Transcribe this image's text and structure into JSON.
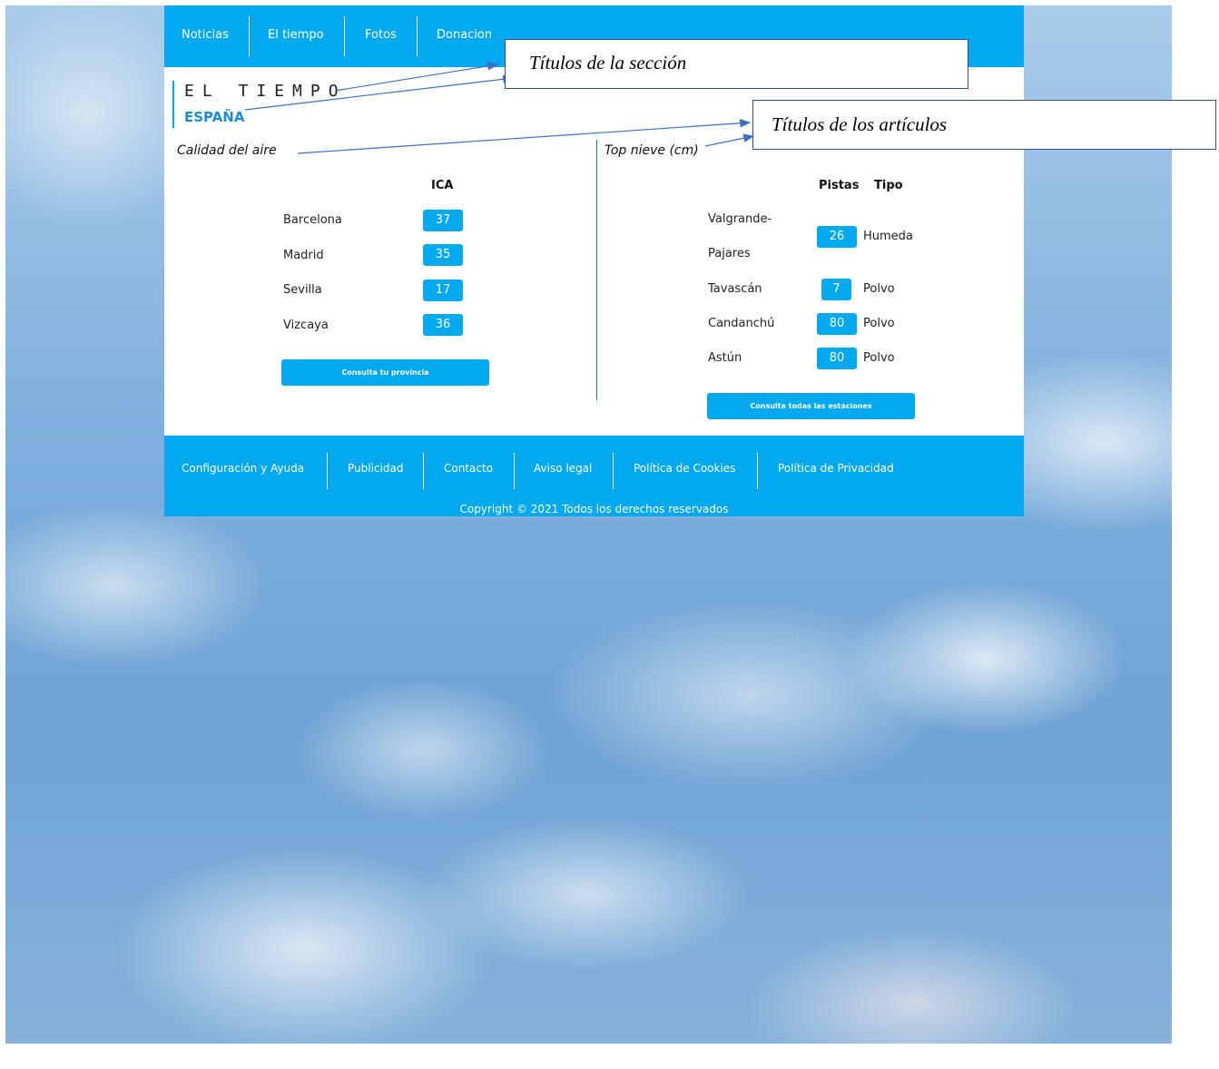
{
  "nav": {
    "items": [
      "Noticias",
      "El tiempo",
      "Fotos",
      "Donacion"
    ]
  },
  "brand": {
    "title": "EL TIEMPO",
    "subtitle": "ESPAÑA"
  },
  "air_quality": {
    "title": "Calidad del aire",
    "header": "ICA",
    "rows": [
      {
        "city": "Barcelona",
        "value": "37"
      },
      {
        "city": "Madrid",
        "value": "35"
      },
      {
        "city": "Sevilla",
        "value": "17"
      },
      {
        "city": "Vizcaya",
        "value": "36"
      }
    ],
    "button_label": "Consulta tu provincia"
  },
  "snow": {
    "title": "Top nieve (cm)",
    "header_pistas": "Pistas",
    "header_tipo": "Tipo",
    "rows": [
      {
        "station_line1": "Valgrande-",
        "station_line2": "Pajares",
        "pistas": "26",
        "tipo": "Humeda"
      },
      {
        "station": "Tavascán",
        "pistas": "7",
        "tipo": "Polvo"
      },
      {
        "station": "Candanchú",
        "pistas": "80",
        "tipo": "Polvo"
      },
      {
        "station": "Astún",
        "pistas": "80",
        "tipo": "Polvo"
      }
    ],
    "button_label": "Consulta todas las estaciones"
  },
  "footer": {
    "links": [
      "Configuración y Ayuda",
      "Publicidad",
      "Contacto",
      "Aviso legal",
      "Política de Cookies",
      "Política de Privacidad"
    ],
    "copyright": "Copyright © 2021 Todos los derechos reservados"
  },
  "callouts": {
    "section_titles": "Títulos de la sección",
    "article_titles": "Títulos de los artículos"
  },
  "colors": {
    "accent": "#03a9ee",
    "subtitle": "#1e8ccf"
  }
}
